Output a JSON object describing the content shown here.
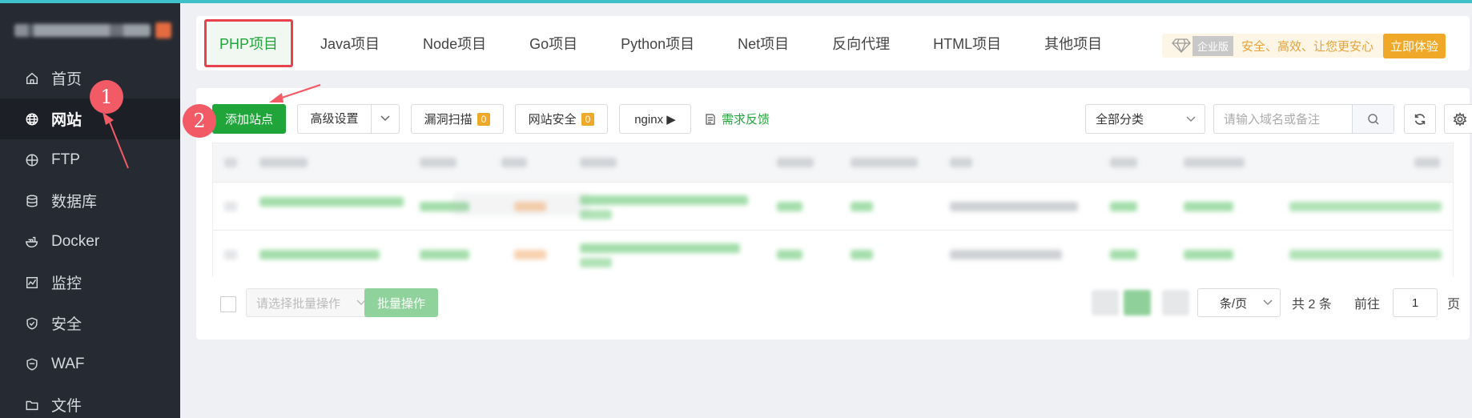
{
  "sidebar": {
    "items": [
      {
        "label": "首页",
        "icon": "home-icon"
      },
      {
        "label": "网站",
        "icon": "globe-icon",
        "active": true
      },
      {
        "label": "FTP",
        "icon": "ftp-icon"
      },
      {
        "label": "数据库",
        "icon": "database-icon"
      },
      {
        "label": "Docker",
        "icon": "docker-icon"
      },
      {
        "label": "监控",
        "icon": "monitor-icon"
      },
      {
        "label": "安全",
        "icon": "shield-icon"
      },
      {
        "label": "WAF",
        "icon": "waf-icon"
      },
      {
        "label": "文件",
        "icon": "folder-icon"
      }
    ]
  },
  "tabs": [
    {
      "label": "PHP项目",
      "active": true
    },
    {
      "label": "Java项目"
    },
    {
      "label": "Node项目"
    },
    {
      "label": "Go项目"
    },
    {
      "label": "Python项目"
    },
    {
      "label": "Net项目"
    },
    {
      "label": "反向代理"
    },
    {
      "label": "HTML项目"
    },
    {
      "label": "其他项目"
    }
  ],
  "promo": {
    "edition": "企业版",
    "text": "安全、高效、让您更安心",
    "button": "立即体验"
  },
  "toolbar": {
    "add_site": "添加站点",
    "advanced": "高级设置",
    "vuln_scan": "漏洞扫描",
    "vuln_scan_count": "0",
    "site_security": "网站安全",
    "site_security_count": "0",
    "nginx": "nginx ▶",
    "feedback": "需求反馈",
    "category": "全部分类",
    "search_placeholder": "请输入域名或备注"
  },
  "footer": {
    "batch_placeholder": "请选择批量操作",
    "batch_button": "批量操作",
    "page_size": "条/页",
    "total": "共 2 条",
    "goto_label": "前往",
    "goto_page": "1",
    "page_unit": "页"
  },
  "annotations": {
    "marker_1": "1",
    "marker_2": "2"
  },
  "colors": {
    "accent": "#20a53a",
    "highlight": "#e8424c",
    "marker": "#f25a66",
    "sidebar": "#262b33"
  }
}
